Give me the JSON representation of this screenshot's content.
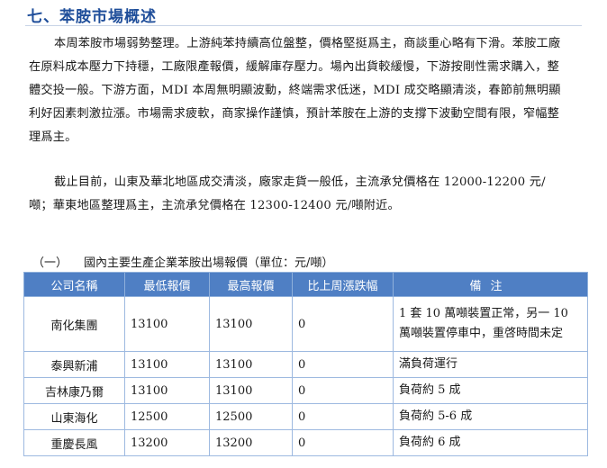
{
  "section_title": "七、苯胺市場概述",
  "paragraphs": [
    "本周苯胺市場弱勢整理。上游純苯持續高位盤整，價格堅挺爲主，商談重心略有下滑。苯胺工廠在原料成本壓力下持穩，工廠限產報價，緩解庫存壓力。場內出貨較緩慢，下游按剛性需求購入，整體交投一般。下游方面，MDI 本周無明顯波動，終端需求低迷，MDI 成交略顯清淡，春節前無明顯利好因素刺激拉漲。市場需求疲軟，商家操作謹慎，預計苯胺在上游的支撐下波動空間有限，窄幅整理爲主。",
    "截止目前，山東及華北地區成交清淡，廠家走貨一般低，主流承兌價格在 12000-12200 元/噸；華東地區整理爲主，主流承兌價格在 12300-12400 元/噸附近。"
  ],
  "table_caption": {
    "number": "（一）",
    "text": "國內主要生產企業苯胺出場報價（單位：元/噸）"
  },
  "table": {
    "headers": [
      "公司名稱",
      "最低報價",
      "最高報價",
      "比上周漲跌幅",
      "備注"
    ],
    "rows": [
      [
        "南化集團",
        "13100",
        "13100",
        "0",
        "1 套 10 萬噸裝置正常，另一 10 萬噸裝置停車中，重啓時間未定"
      ],
      [
        "泰興新浦",
        "13100",
        "13100",
        "0",
        "滿負荷運行"
      ],
      [
        "吉林康乃爾",
        "13100",
        "13100",
        "0",
        "負荷約 5 成"
      ],
      [
        "山東海化",
        "12500",
        "12500",
        "0",
        "負荷約 5-6 成"
      ],
      [
        "重慶長風",
        "13200",
        "13200",
        "0",
        "負荷約 6 成"
      ]
    ]
  }
}
